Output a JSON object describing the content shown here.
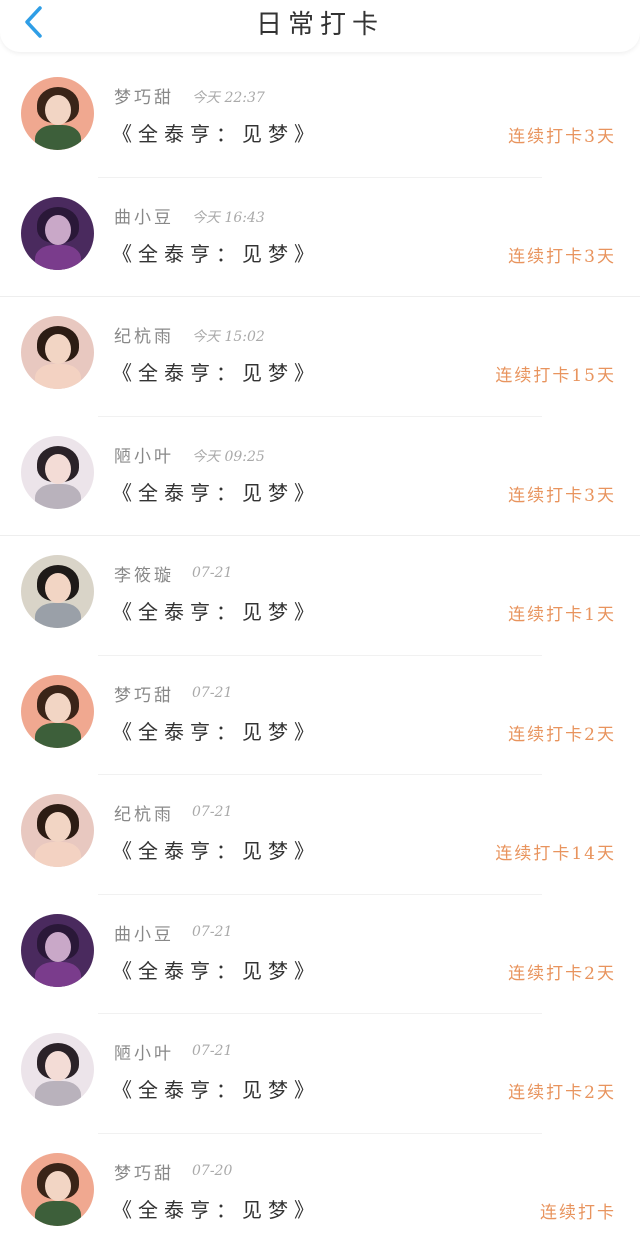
{
  "header": {
    "title": "日常打卡"
  },
  "colors": {
    "accent": "#2f9ee6",
    "streak": "#e8945e"
  },
  "checkins": [
    {
      "name": "梦巧甜",
      "time": "今天 22:37",
      "task": "《全泰亨：见梦》",
      "streak": "连续打卡3天",
      "avatar": "girl-flowers"
    },
    {
      "name": "曲小豆",
      "time": "今天 16:43",
      "task": "《全泰亨：见梦》",
      "streak": "连续打卡3天",
      "avatar": "purple-dress"
    },
    {
      "name": "纪杭雨",
      "time": "今天 15:02",
      "task": "《全泰亨：见梦》",
      "streak": "连续打卡15天",
      "avatar": "portrait-pink"
    },
    {
      "name": "陋小叶",
      "time": "今天 09:25",
      "task": "《全泰亨：见梦》",
      "streak": "连续打卡3天",
      "avatar": "mirror-selfie"
    },
    {
      "name": "李筱璇",
      "time": "07-21",
      "task": "《全泰亨：见梦》",
      "streak": "连续打卡1天",
      "avatar": "girl-hoodie"
    },
    {
      "name": "梦巧甜",
      "time": "07-21",
      "task": "《全泰亨：见梦》",
      "streak": "连续打卡2天",
      "avatar": "girl-flowers"
    },
    {
      "name": "纪杭雨",
      "time": "07-21",
      "task": "《全泰亨：见梦》",
      "streak": "连续打卡14天",
      "avatar": "portrait-pink"
    },
    {
      "name": "曲小豆",
      "time": "07-21",
      "task": "《全泰亨：见梦》",
      "streak": "连续打卡2天",
      "avatar": "purple-dress"
    },
    {
      "name": "陋小叶",
      "time": "07-21",
      "task": "《全泰亨：见梦》",
      "streak": "连续打卡2天",
      "avatar": "mirror-selfie"
    },
    {
      "name": "梦巧甜",
      "time": "07-20",
      "task": "《全泰亨：见梦》",
      "streak": "连续打卡",
      "avatar": "girl-flowers"
    }
  ]
}
